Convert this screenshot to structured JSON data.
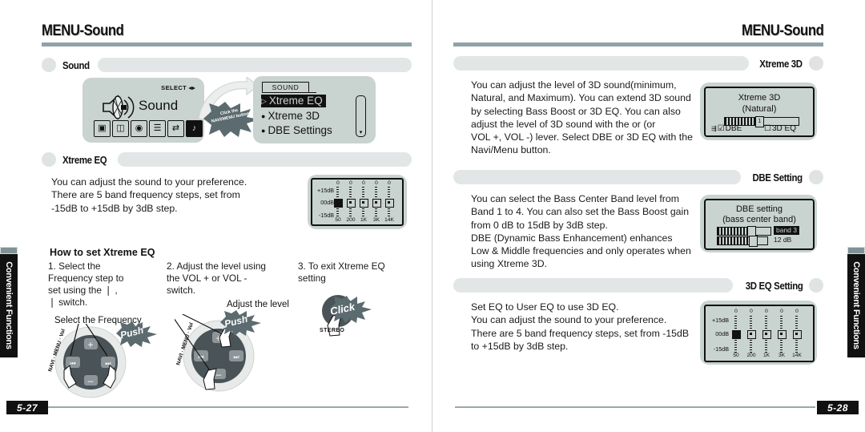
{
  "left_page": {
    "running_head": "MENU-Sound",
    "folio": "5-27",
    "side_tab": "Convenient Functions",
    "sections": {
      "sound": {
        "label": "Sound",
        "device_screen": {
          "select_label": "SELECT",
          "select_icon": "left-right-arrows-icon",
          "title": "Sound",
          "speaker_icon": "speaker-icon",
          "icons": [
            {
              "name": "globe-icon",
              "glyph": "⬟",
              "selected": false
            },
            {
              "name": "monitor-icon",
              "glyph": "▣",
              "selected": false
            },
            {
              "name": "clock-icon",
              "glyph": "◷",
              "selected": false
            },
            {
              "name": "tools-icon",
              "glyph": "✕",
              "selected": false
            },
            {
              "name": "repeat-icon",
              "glyph": "⇄",
              "selected": false
            },
            {
              "name": "music-note-icon",
              "glyph": "♪",
              "selected": true
            }
          ]
        },
        "callout": "Click the\nNAVI/MENU button",
        "menu_screen": {
          "title": "SOUND",
          "items": [
            {
              "marker": "▷",
              "label": "Xtreme EQ",
              "highlighted": true
            },
            {
              "marker": "●",
              "label": "Xtreme 3D",
              "highlighted": false
            },
            {
              "marker": "●",
              "label": "DBE Settings",
              "highlighted": false
            }
          ],
          "scrollbar": "vertical-scrollbar"
        }
      },
      "xtreme_eq": {
        "label": "Xtreme EQ",
        "body": "You can adjust the sound to your preference.\nThere are 5 band frequency steps, set from\n-15dB to +15dB by 3dB step.",
        "eq_panel": {
          "scale_labels": [
            "+15dB",
            "00dB",
            "-15dB"
          ],
          "bands": [
            "50",
            "200",
            "1K",
            "3K",
            "14K"
          ],
          "values": [
            "0",
            "0",
            "0",
            "0",
            "0"
          ],
          "selected_band_index": 0
        }
      },
      "how_to": {
        "title": "How to set Xtreme EQ",
        "steps": [
          "1. Select the\n    Frequency step to\n    set using the ❘        ,\n          ❘ switch.",
          "2. Adjust the level using\n    the VOL + or VOL -\n    switch.",
          "3. To exit Xtreme EQ\n    setting"
        ],
        "callouts": {
          "select_frequency": "Select the Frequency",
          "adjust_level": "Adjust the level",
          "push_1": "Push",
          "push_2": "Push",
          "click": "Click",
          "stereo": "STEREO",
          "jog_label": "NAVI · MENU · Vol"
        }
      }
    }
  },
  "right_page": {
    "running_head": "MENU-Sound",
    "folio": "5-28",
    "side_tab": "Convenient Functions",
    "sections": {
      "xtreme_3d": {
        "label": "Xtreme 3D",
        "body": "You can adjust the level of 3D sound(minimum,\nNatural, and Maximum). You can extend 3D sound\nby selecting Bass Boost or 3D EQ. You can also\nadjust the level of 3D sound with the        or        (or\nVOL +, VOL -) lever. Select DBE or 3D EQ with the\nNavi/Menu button.",
        "panel": {
          "title": "Xtreme  3D",
          "subtitle": "(Natural)",
          "slider_value": "1",
          "checkbox_dbe": "DBE",
          "checkbox_dbe_checked": true,
          "checkbox_3deq": "3D EQ",
          "checkbox_3deq_checked": false,
          "pointer_icon": "right-arrow-icon"
        }
      },
      "dbe_setting": {
        "label": "DBE Setting",
        "body": "You can select the Bass Center Band level from\nBand 1 to 4. You can also set the Bass Boost gain\nfrom 0 dB to 15dB by 3dB step.\nDBE (Dynamic Bass Enhancement) enhances\nLow & Middle frequencies and only operates when\nusing Xtreme 3D.",
        "panel": {
          "title": "DBE setting",
          "subtitle": "(bass center band)",
          "slider_1_value": "band 3",
          "slider_2_value": "12 dB"
        }
      },
      "eq_3d_setting": {
        "label": "3D EQ Setting",
        "body": "Set EQ to User EQ to use 3D EQ.\nYou can adjust the sound to your preference.\nThere are 5 band frequency steps, set from -15dB\nto +15dB by 3dB step.",
        "eq_panel": {
          "scale_labels": [
            "+15dB",
            "00dB",
            "-15dB"
          ],
          "bands": [
            "50",
            "200",
            "1K",
            "3K",
            "14K"
          ],
          "values": [
            "0",
            "0",
            "0",
            "0",
            "0"
          ],
          "selected_band_index": 0
        }
      }
    }
  },
  "colors": {
    "rule": "#8fa3a6",
    "bar": "#e3e6e6",
    "lcd": "#c9d3cf",
    "ink": "#111111"
  }
}
